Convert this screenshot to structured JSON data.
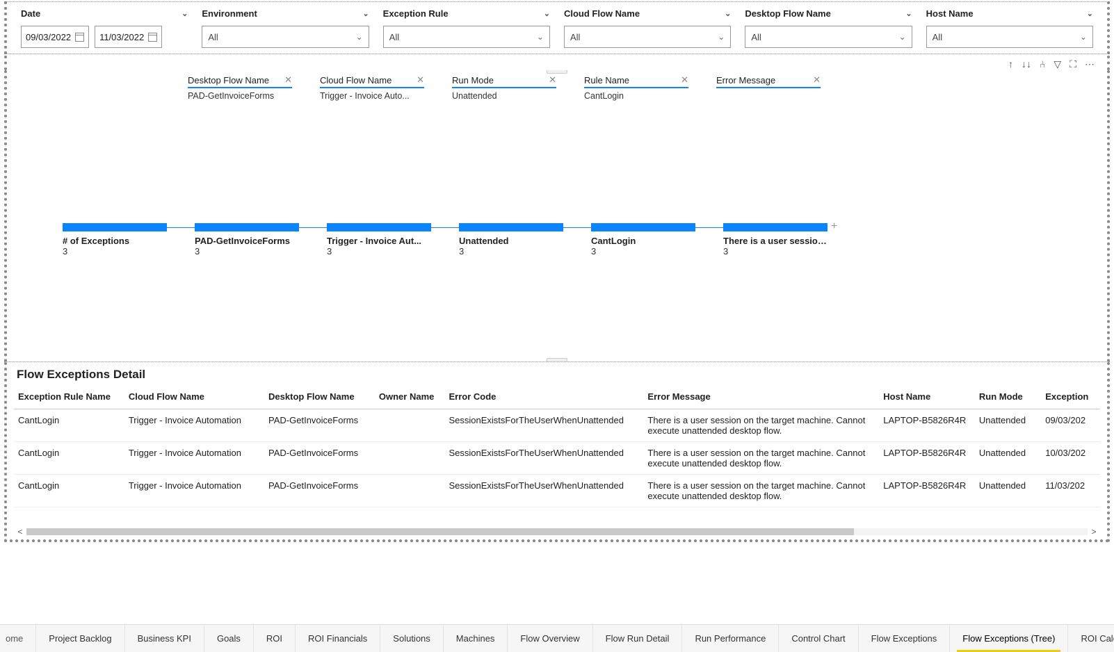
{
  "filters": {
    "date": {
      "label": "Date",
      "from": "09/03/2022",
      "to": "11/03/2022"
    },
    "environment": {
      "label": "Environment",
      "value": "All"
    },
    "exception_rule": {
      "label": "Exception Rule",
      "value": "All"
    },
    "cloud_flow": {
      "label": "Cloud Flow Name",
      "value": "All"
    },
    "desktop_flow": {
      "label": "Desktop Flow Name",
      "value": "All"
    },
    "host": {
      "label": "Host Name",
      "value": "All"
    }
  },
  "dcomp": {
    "headers": [
      {
        "title": "Desktop Flow Name",
        "sub": "PAD-GetInvoiceForms"
      },
      {
        "title": "Cloud Flow Name",
        "sub": "Trigger - Invoice Auto..."
      },
      {
        "title": "Run Mode",
        "sub": "Unattended"
      },
      {
        "title": "Rule Name",
        "sub": "CantLogin"
      },
      {
        "title": "Error Message",
        "sub": ""
      }
    ],
    "nodes": [
      {
        "label": "# of Exceptions",
        "value": "3"
      },
      {
        "label": "PAD-GetInvoiceForms",
        "value": "3"
      },
      {
        "label": "Trigger - Invoice Aut...",
        "value": "3"
      },
      {
        "label": "Unattended",
        "value": "3"
      },
      {
        "label": "CantLogin",
        "value": "3"
      },
      {
        "label": "There is a user session ...",
        "value": "3"
      }
    ]
  },
  "detail": {
    "title": "Flow Exceptions Detail",
    "cols": [
      "Exception Rule Name",
      "Cloud Flow Name",
      "Desktop Flow Name",
      "Owner Name",
      "Error Code",
      "Error Message",
      "Host Name",
      "Run Mode",
      "Exception"
    ],
    "rows": [
      {
        "rule": "CantLogin",
        "cloud": "Trigger - Invoice Automation",
        "desktop": "PAD-GetInvoiceForms",
        "owner": "",
        "code": "SessionExistsForTheUserWhenUnattended",
        "msg": "There is a user session on the target machine. Cannot execute unattended desktop flow.",
        "host": "LAPTOP-B5826R4R",
        "mode": "Unattended",
        "date": "09/03/202"
      },
      {
        "rule": "CantLogin",
        "cloud": "Trigger - Invoice Automation",
        "desktop": "PAD-GetInvoiceForms",
        "owner": "",
        "code": "SessionExistsForTheUserWhenUnattended",
        "msg": "There is a user session on the target machine. Cannot execute unattended desktop flow.",
        "host": "LAPTOP-B5826R4R",
        "mode": "Unattended",
        "date": "10/03/202"
      },
      {
        "rule": "CantLogin",
        "cloud": "Trigger - Invoice Automation",
        "desktop": "PAD-GetInvoiceForms",
        "owner": "",
        "code": "SessionExistsForTheUserWhenUnattended",
        "msg": "There is a user session on the target machine. Cannot execute unattended desktop flow.",
        "host": "LAPTOP-B5826R4R",
        "mode": "Unattended",
        "date": "11/03/202"
      }
    ]
  },
  "tabs": {
    "cut": "ome",
    "items": [
      "Project Backlog",
      "Business KPI",
      "Goals",
      "ROI",
      "ROI Financials",
      "Solutions",
      "Machines",
      "Flow Overview",
      "Flow Run Detail",
      "Run Performance",
      "Control Chart",
      "Flow Exceptions",
      "Flow Exceptions (Tree)",
      "ROI Calculations"
    ],
    "active": "Flow Exceptions (Tree)"
  }
}
